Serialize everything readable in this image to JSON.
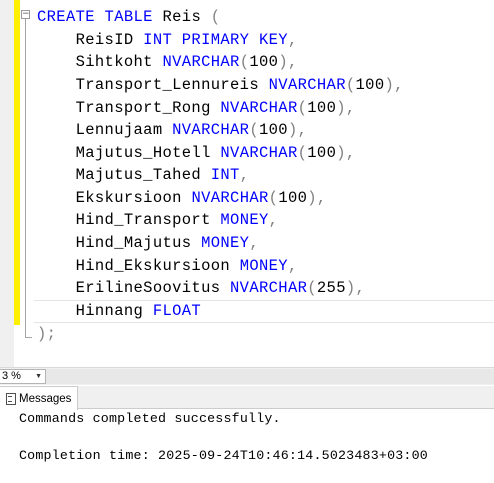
{
  "editor": {
    "lines": [
      [
        {
          "t": "CREATE TABLE ",
          "k": "kw"
        },
        {
          "t": "Reis "
        },
        {
          "t": "(",
          "k": "gray"
        }
      ],
      [
        {
          "t": "    ReisID "
        },
        {
          "t": "INT PRIMARY KEY",
          "k": "kw"
        },
        {
          "t": ",",
          "k": "gray"
        }
      ],
      [
        {
          "t": "    Sihtkoht "
        },
        {
          "t": "NVARCHAR",
          "k": "kw"
        },
        {
          "t": "(",
          "k": "gray"
        },
        {
          "t": "100"
        },
        {
          "t": "),",
          "k": "gray"
        }
      ],
      [
        {
          "t": "    Transport_Lennureis "
        },
        {
          "t": "NVARCHAR",
          "k": "kw"
        },
        {
          "t": "(",
          "k": "gray"
        },
        {
          "t": "100"
        },
        {
          "t": "),",
          "k": "gray"
        }
      ],
      [
        {
          "t": "    Transport_Rong "
        },
        {
          "t": "NVARCHAR",
          "k": "kw"
        },
        {
          "t": "(",
          "k": "gray"
        },
        {
          "t": "100"
        },
        {
          "t": "),",
          "k": "gray"
        }
      ],
      [
        {
          "t": "    Lennujaam "
        },
        {
          "t": "NVARCHAR",
          "k": "kw"
        },
        {
          "t": "(",
          "k": "gray"
        },
        {
          "t": "100"
        },
        {
          "t": "),",
          "k": "gray"
        }
      ],
      [
        {
          "t": "    Majutus_Hotell "
        },
        {
          "t": "NVARCHAR",
          "k": "kw"
        },
        {
          "t": "(",
          "k": "gray"
        },
        {
          "t": "100"
        },
        {
          "t": "),",
          "k": "gray"
        }
      ],
      [
        {
          "t": "    Majutus_Tahed "
        },
        {
          "t": "INT",
          "k": "kw"
        },
        {
          "t": ",",
          "k": "gray"
        }
      ],
      [
        {
          "t": "    Ekskursioon "
        },
        {
          "t": "NVARCHAR",
          "k": "kw"
        },
        {
          "t": "(",
          "k": "gray"
        },
        {
          "t": "100"
        },
        {
          "t": "),",
          "k": "gray"
        }
      ],
      [
        {
          "t": "    Hind_Transport "
        },
        {
          "t": "MONEY",
          "k": "kw"
        },
        {
          "t": ",",
          "k": "gray"
        }
      ],
      [
        {
          "t": "    Hind_Majutus "
        },
        {
          "t": "MONEY",
          "k": "kw"
        },
        {
          "t": ",",
          "k": "gray"
        }
      ],
      [
        {
          "t": "    Hind_Ekskursioon "
        },
        {
          "t": "MONEY",
          "k": "kw"
        },
        {
          "t": ",",
          "k": "gray"
        }
      ],
      [
        {
          "t": "    ErilineSoovitus "
        },
        {
          "t": "NVARCHAR",
          "k": "kw"
        },
        {
          "t": "(",
          "k": "gray"
        },
        {
          "t": "255"
        },
        {
          "t": "),",
          "k": "gray"
        }
      ],
      [
        {
          "t": "    Hinnang "
        },
        {
          "t": "FLOAT",
          "k": "kw"
        }
      ],
      [
        {
          "t": ");",
          "k": "gray"
        }
      ]
    ],
    "collapse_glyph": "−"
  },
  "zoom": {
    "value": "3 %",
    "arrow": "▼"
  },
  "results": {
    "tab_label": "Messages",
    "messages": [
      "Commands completed successfully.",
      "",
      "Completion time: 2025-09-24T10:46:14.5023483+03:00"
    ]
  },
  "colors": {
    "keyword": "#0000ff",
    "punctuation": "#808080",
    "change_bar": "#ffef00"
  }
}
